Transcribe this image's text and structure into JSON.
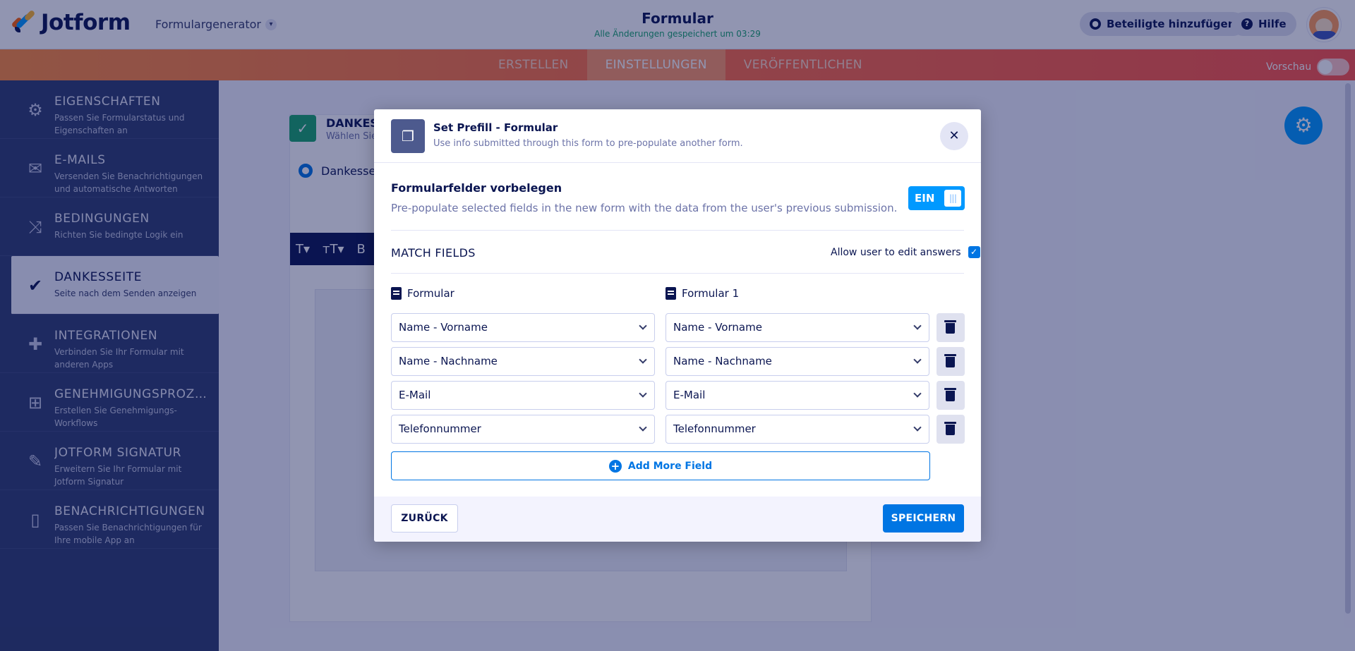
{
  "header": {
    "logo_text": "Jotform",
    "generator_label": "Formulargenerator",
    "form_title": "Formular",
    "save_status": "Alle Änderungen gespeichert um 03:29",
    "add_participants": "Beteiligte hinzufügen",
    "help": "Hilfe"
  },
  "tabs": [
    {
      "label": "ERSTELLEN",
      "active": false
    },
    {
      "label": "EINSTELLUNGEN",
      "active": true
    },
    {
      "label": "VERÖFFENTLICHEN",
      "active": false
    }
  ],
  "preview": {
    "label": "Vorschau",
    "on": false
  },
  "sidebar": {
    "items": [
      {
        "title": "EIGENSCHAFTEN",
        "desc": "Passen Sie Formularstatus und Eigenschaften an",
        "icon": "gear-icon"
      },
      {
        "title": "E-MAILS",
        "desc": "Versenden Sie Benachrichtigungen und automatische Antworten",
        "icon": "mail-icon"
      },
      {
        "title": "BEDINGUNGEN",
        "desc": "Richten Sie bedingte Logik ein",
        "icon": "shuffle-icon"
      },
      {
        "title": "DANKESSEITE",
        "desc": "Seite nach dem Senden anzeigen",
        "icon": "check-circle-icon",
        "active": true
      },
      {
        "title": "INTEGRATIONEN",
        "desc": "Verbinden Sie Ihr Formular mit anderen Apps",
        "icon": "puzzle-icon"
      },
      {
        "title": "GENEHMIGUNGSPROZESSE",
        "desc": "Erstellen Sie Genehmigungs-Workflows",
        "icon": "workflow-icon"
      },
      {
        "title": "JOTFORM SIGNATUR",
        "desc": "Erweitern Sie Ihr Formular mit Jotform Signatur",
        "icon": "pen-icon"
      },
      {
        "title": "BENACHRICHTIGUNGEN",
        "desc": "Passen Sie Benachrichtigungen für Ihre mobile App an",
        "icon": "phone-icon"
      }
    ]
  },
  "background": {
    "thankyou_title": "DANKESS",
    "thankyou_sub": "Wählen Sie",
    "radio_label": "Dankessei"
  },
  "modal": {
    "title": "Set Prefill - Formular",
    "subtitle": "Use info submitted through this form to pre-populate another form.",
    "section_title": "Formularfelder vorbelegen",
    "section_desc": "Pre-populate selected fields in the new form with the data from the user's previous submission.",
    "toggle_label": "EIN",
    "match_fields": "MATCH FIELDS",
    "allow_edit": "Allow user to edit answers",
    "allow_edit_checked": true,
    "source_form": "Formular",
    "target_form": "Formular 1",
    "rows": [
      {
        "source": "Name - Vorname",
        "target": "Name - Vorname"
      },
      {
        "source": "Name - Nachname",
        "target": "Name - Nachname"
      },
      {
        "source": "E-Mail",
        "target": "E-Mail"
      },
      {
        "source": "Telefonnummer",
        "target": "Telefonnummer"
      }
    ],
    "add_more": "Add More Field",
    "back": "ZURÜCK",
    "save": "SPEICHERN"
  },
  "colors": {
    "navy": "#0a1551",
    "accent_blue": "#0075e3",
    "toggle_blue": "#0099ff",
    "tab_orange": "#ff6d43",
    "sidebar": "#2f3c6d"
  }
}
